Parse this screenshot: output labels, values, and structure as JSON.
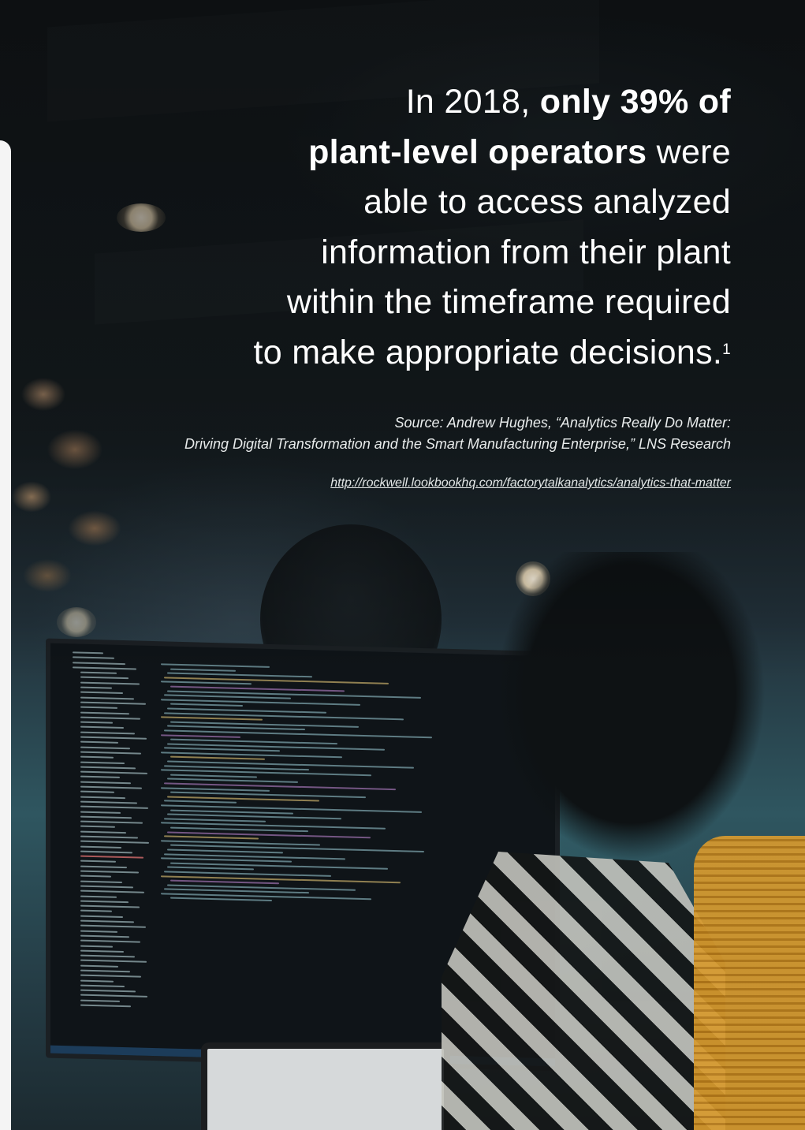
{
  "headline": {
    "line1_pre": "In 2018, ",
    "line1_bold": "only 39% of",
    "line2_bold": "plant-level operators",
    "line2_post": " were",
    "line3": "able to access analyzed",
    "line4": "information from their plant",
    "line5": "within the timeframe required",
    "line6": "to make appropriate decisions.",
    "footnote_marker": "1"
  },
  "source": {
    "line1": "Source: Andrew Hughes, “Analytics Really Do Matter:",
    "line2": "Driving Digital Transformation and the Smart Manufacturing Enterprise,” LNS Research"
  },
  "link": {
    "text": "http://rockwell.lookbookhq.com/factorytalkanalytics/analytics-that-matter"
  },
  "colors": {
    "text": "#ffffff",
    "background": "#141a1e"
  }
}
